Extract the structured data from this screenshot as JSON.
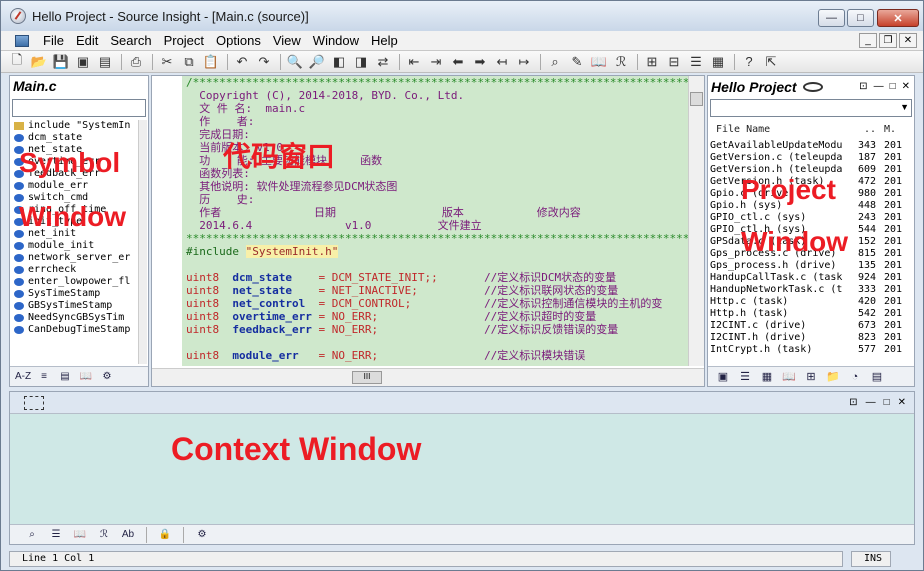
{
  "window": {
    "title": "Hello Project - Source Insight - [Main.c (source)]",
    "minimize": "—",
    "maximize": "□",
    "close": "✕"
  },
  "menu": {
    "items": [
      "File",
      "Edit",
      "Search",
      "Project",
      "Options",
      "View",
      "Window",
      "Help"
    ],
    "mdi_buttons": [
      "_",
      "❐",
      "✕"
    ]
  },
  "toolbar": {
    "icons": [
      "new-file-icon",
      "open-icon",
      "save-icon",
      "save-all-icon",
      "close-file-icon",
      "print-icon",
      "cut-icon",
      "copy-icon",
      "paste-icon",
      "undo-icon",
      "redo-icon",
      "search-icon",
      "search-files-icon",
      "search-backward-icon",
      "search-forward-icon",
      "replace-icon",
      "bookmark-prev-icon",
      "bookmark-next-icon",
      "go-back-icon",
      "go-forward-icon",
      "jump-caller-icon",
      "jump-definition-icon",
      "lookup-icon",
      "browse-icon",
      "relation-icon",
      "cascade-icon",
      "tile-icon",
      "window-list-icon",
      "layout-icon",
      "help-icon",
      "context-help-icon"
    ]
  },
  "symbol_window": {
    "title": "Main.c",
    "items": [
      {
        "icon": "include-icon",
        "name": "include \"SystemIn"
      },
      {
        "icon": "var-icon",
        "name": "dcm_state"
      },
      {
        "icon": "var-icon",
        "name": "net_state"
      },
      {
        "icon": "var-icon",
        "name": "overtime_err"
      },
      {
        "icon": "var-icon",
        "name": "feedback_err"
      },
      {
        "icon": "var-icon",
        "name": "module_err"
      },
      {
        "icon": "var-icon",
        "name": "switch_cmd"
      },
      {
        "icon": "var-icon",
        "name": "ring_off_time"
      },
      {
        "icon": "var-icon",
        "name": "init_type"
      },
      {
        "icon": "var-icon",
        "name": "net_init"
      },
      {
        "icon": "var-icon",
        "name": "module_init"
      },
      {
        "icon": "var-icon",
        "name": "network_server_er"
      },
      {
        "icon": "var-icon",
        "name": "errcheck"
      },
      {
        "icon": "var-icon",
        "name": "enter_lowpower_fl"
      },
      {
        "icon": "var-icon",
        "name": "SysTimeStamp"
      },
      {
        "icon": "var-icon",
        "name": "GBSysTimeStamp"
      },
      {
        "icon": "var-icon",
        "name": "NeedSyncGBSysTim"
      },
      {
        "icon": "var-icon",
        "name": "CanDebugTimeStamp"
      }
    ],
    "tools": [
      "A-Z",
      "≡",
      "▤",
      "📖",
      "⚙"
    ]
  },
  "code": {
    "header_lines": [
      "/*******************************************************************************",
      "  Copyright (C), 2014-2018, BYD. Co., Ltd.",
      "  文 件 名:  main.c",
      "  作    者:",
      "  完成日期:",
      "  当前版本: v1.0",
      "  功    能: 主要功能模块     函数",
      "  函数列表:",
      "  其他说明: 软件处理流程参见DCM状态图",
      "  历    史:",
      "  作者              日期                版本           修改内容",
      "  2014.6.4              v1.0          文件建立",
      "********************************************************************************"
    ],
    "include_directive": "#include",
    "include_file": "\"SystemInit.h\"",
    "decls": [
      {
        "type": "uint8",
        "name": "dcm_state",
        "eq": "= ",
        "value": "DCM_STATE_INIT;;",
        "comment": "//定义标识DCM状态的变量"
      },
      {
        "type": "uint8",
        "name": "net_state",
        "eq": "= ",
        "value": "NET_INACTIVE;",
        "comment": "//定义标识联网状态的变量"
      },
      {
        "type": "uint8",
        "name": "net_control",
        "eq": "= ",
        "value": "DCM_CONTROL;",
        "comment": "//定义标识控制通信模块的主机的变"
      },
      {
        "type": "uint8",
        "name": "overtime_err",
        "eq": "= ",
        "value": "NO_ERR;",
        "comment": "//定义标识超时的变量"
      },
      {
        "type": "uint8",
        "name": "feedback_err",
        "eq": "= ",
        "value": "NO_ERR;",
        "comment": "//定义标识反馈错误的变量"
      }
    ],
    "decl_last": {
      "type": "uint8",
      "name": "module_err",
      "eq": "= ",
      "value": "NO_ERR;",
      "comment": "//定义标识模块错误"
    },
    "scroll_thumb": "III"
  },
  "project_window": {
    "title": "Hello Project",
    "col_file": "File Name",
    "col_size": "..",
    "col_mod": "M.",
    "files": [
      {
        "name": "GetAvailableUpdateModu",
        "size": "343",
        "mod": "201"
      },
      {
        "name": "GetVersion.c (teleupda",
        "size": "187",
        "mod": "201"
      },
      {
        "name": "GetVersion.h (teleupda",
        "size": "609",
        "mod": "201"
      },
      {
        "name": "GetVersion.h (task)",
        "size": "472",
        "mod": "201"
      },
      {
        "name": "Gpio.c (drive)",
        "size": "980",
        "mod": "201"
      },
      {
        "name": "Gpio.h (sys)",
        "size": "448",
        "mod": "201"
      },
      {
        "name": "GPIO_ctl.c (sys)",
        "size": "243",
        "mod": "201"
      },
      {
        "name": "GPIO_ctl.h (sys)",
        "size": "544",
        "mod": "201"
      },
      {
        "name": "GPSdata.c (task)",
        "size": "152",
        "mod": "201"
      },
      {
        "name": "Gps_process.c (drive)",
        "size": "815",
        "mod": "201"
      },
      {
        "name": "Gps_process.h (drive)",
        "size": "135",
        "mod": "201"
      },
      {
        "name": "HandupCallTask.c (task",
        "size": "924",
        "mod": "201"
      },
      {
        "name": "HandupNetworkTask.c (t",
        "size": "333",
        "mod": "201"
      },
      {
        "name": "Http.c (task)",
        "size": "420",
        "mod": "201"
      },
      {
        "name": "Http.h (task)",
        "size": "542",
        "mod": "201"
      },
      {
        "name": "I2CINT.c (drive)",
        "size": "673",
        "mod": "201"
      },
      {
        "name": "I2CINT.h (drive)",
        "size": "823",
        "mod": "201"
      },
      {
        "name": "IntCrypt.h (task)",
        "size": "577",
        "mod": "201"
      }
    ]
  },
  "context_window": {
    "tools": [
      "lookup-icon",
      "list-icon",
      "book-icon",
      "browse-icon",
      "abc-icon",
      "lock-icon",
      "settings-icon"
    ]
  },
  "status": {
    "position": "Line 1  Col 1",
    "mode": "INS"
  },
  "annotations": {
    "symbol_line1": "Symbol",
    "symbol_line2": "Window",
    "code": "代码窗口",
    "project_line1": "Project",
    "project_line2": "Window",
    "context": "Context Window"
  },
  "colors": {
    "code_bg": "#cfe8cc",
    "context_bg": "#cfe8e6",
    "annotation": "#ec1c24"
  }
}
